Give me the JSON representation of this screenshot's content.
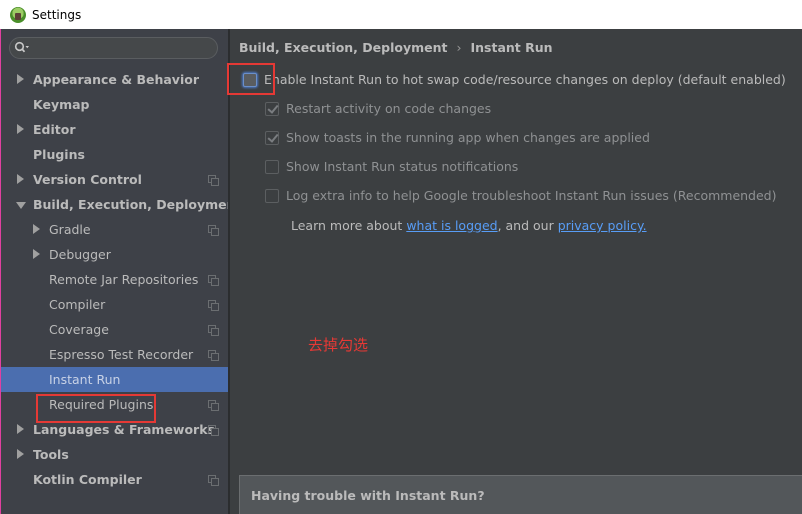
{
  "window": {
    "title": "Settings",
    "app_icon": "android-studio-icon"
  },
  "sidebar": {
    "search": {
      "placeholder": "",
      "value": "",
      "icon": "search-icon"
    },
    "items": [
      {
        "label": "Appearance & Behavior",
        "level": 0,
        "expand": "collapsed",
        "bold": true,
        "copy_icon": false
      },
      {
        "label": "Keymap",
        "level": 0,
        "expand": "none",
        "bold": true,
        "copy_icon": false
      },
      {
        "label": "Editor",
        "level": 0,
        "expand": "collapsed",
        "bold": true,
        "copy_icon": false
      },
      {
        "label": "Plugins",
        "level": 0,
        "expand": "none",
        "bold": true,
        "copy_icon": false
      },
      {
        "label": "Version Control",
        "level": 0,
        "expand": "collapsed",
        "bold": true,
        "copy_icon": true
      },
      {
        "label": "Build, Execution, Deployment",
        "level": 0,
        "expand": "expanded",
        "bold": true,
        "copy_icon": false
      },
      {
        "label": "Gradle",
        "level": 1,
        "expand": "collapsed",
        "bold": false,
        "copy_icon": true
      },
      {
        "label": "Debugger",
        "level": 1,
        "expand": "collapsed",
        "bold": false,
        "copy_icon": false
      },
      {
        "label": "Remote Jar Repositories",
        "level": 1,
        "expand": "none",
        "bold": false,
        "copy_icon": true
      },
      {
        "label": "Compiler",
        "level": 1,
        "expand": "none",
        "bold": false,
        "copy_icon": true
      },
      {
        "label": "Coverage",
        "level": 1,
        "expand": "none",
        "bold": false,
        "copy_icon": true
      },
      {
        "label": "Espresso Test Recorder",
        "level": 1,
        "expand": "none",
        "bold": false,
        "copy_icon": true
      },
      {
        "label": "Instant Run",
        "level": 1,
        "expand": "none",
        "bold": false,
        "copy_icon": false,
        "selected": true
      },
      {
        "label": "Required Plugins",
        "level": 1,
        "expand": "none",
        "bold": false,
        "copy_icon": true
      },
      {
        "label": "Languages & Frameworks",
        "level": 0,
        "expand": "collapsed",
        "bold": true,
        "copy_icon": true
      },
      {
        "label": "Tools",
        "level": 0,
        "expand": "collapsed",
        "bold": true,
        "copy_icon": false
      },
      {
        "label": "Kotlin Compiler",
        "level": 0,
        "expand": "none",
        "bold": true,
        "copy_icon": true
      }
    ]
  },
  "main": {
    "breadcrumb": {
      "parent": "Build, Execution, Deployment",
      "separator": "›",
      "current": "Instant Run"
    },
    "options": [
      {
        "label": "Enable Instant Run to hot swap code/resource changes on deploy (default enabled)",
        "checked": false,
        "enabled": true,
        "focused": true
      },
      {
        "label": "Restart activity on code changes",
        "checked": true,
        "enabled": false
      },
      {
        "label": "Show toasts in the running app when changes are applied",
        "checked": true,
        "enabled": false
      },
      {
        "label": "Show Instant Run status notifications",
        "checked": false,
        "enabled": false
      },
      {
        "label": "Log extra info to help Google troubleshoot Instant Run issues (Recommended)",
        "checked": false,
        "enabled": false
      }
    ],
    "learn_more": {
      "prefix": "Learn more about ",
      "link1": "what is logged",
      "middle": ", and our ",
      "link2": "privacy policy."
    },
    "annotation": "去掉勾选",
    "trouble_panel": {
      "heading": "Having trouble with Instant Run?"
    }
  },
  "colors": {
    "accent_selection": "#4b6eaf",
    "annotation_red": "#e53935",
    "link_blue": "#589df6"
  }
}
